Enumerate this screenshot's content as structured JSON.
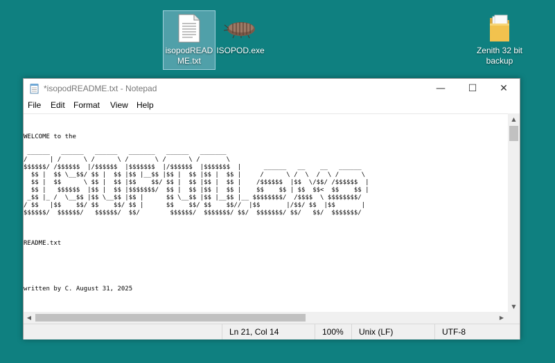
{
  "desktop": {
    "icons": [
      {
        "label": "isopodREADME.txt",
        "icon": "text-file-icon"
      },
      {
        "label": "ISOPOD.exe",
        "icon": "isopod-icon"
      },
      {
        "label": "Zenith 32 bit backup",
        "icon": "folder-icon"
      }
    ]
  },
  "notepad": {
    "title": "*isopodREADME.txt - Notepad",
    "controls": {
      "minimize": "—",
      "maximize": "☐",
      "close": "✕"
    },
    "menu": [
      "File",
      "Edit",
      "Format",
      "View",
      "Help"
    ],
    "content": "WELCOME to the\n\n ______   ______   ______   _______   ______   _______\n/      | /      \\ /      \\ /       \\ /      \\ /       \\\n$$$$$$/ /$$$$$$  |/$$$$$$  |$$$$$$$  |/$$$$$$  |$$$$$$$  |      ______   __    __   ______\n  $$ |  $$ \\__$$/ $$ |  $$ |$$ |__$$ |$$ |  $$ |$$ |  $$ |     /      \\ /  \\  /  \\ /      \\\n  $$ |  $$      \\ $$ |  $$ |$$    $$/ $$ |  $$ |$$ |  $$ |    /$$$$$$  |$$  \\/$$/ /$$$$$$  |\n  $$ |   $$$$$$  |$$ |  $$ |$$$$$$$/  $$ |  $$ |$$ |  $$ |    $$    $$ | $$  $$<  $$    $$ |\n _$$ |_ /  \\__$$ |$$ \\__$$ |$$ |      $$ \\__$$ |$$ |__$$ |__ $$$$$$$$/  /$$$$  \\ $$$$$$$$/\n/ $$   |$$    $$/ $$    $$/ $$ |      $$    $$/ $$    $$//  |$$       |/$$/ $$  |$$       |\n$$$$$$/  $$$$$$/   $$$$$$/  $$/        $$$$$$/  $$$$$$$/ $$/  $$$$$$$/ $$/   $$/  $$$$$$$/\n\n\n\nREADME.txt\n\n\n\n\n\nwritten by C. August 31, 2025",
    "status": {
      "position": "Ln 21, Col 14",
      "zoom": "100%",
      "line_ending": "Unix (LF)",
      "encoding": "UTF-8"
    }
  }
}
